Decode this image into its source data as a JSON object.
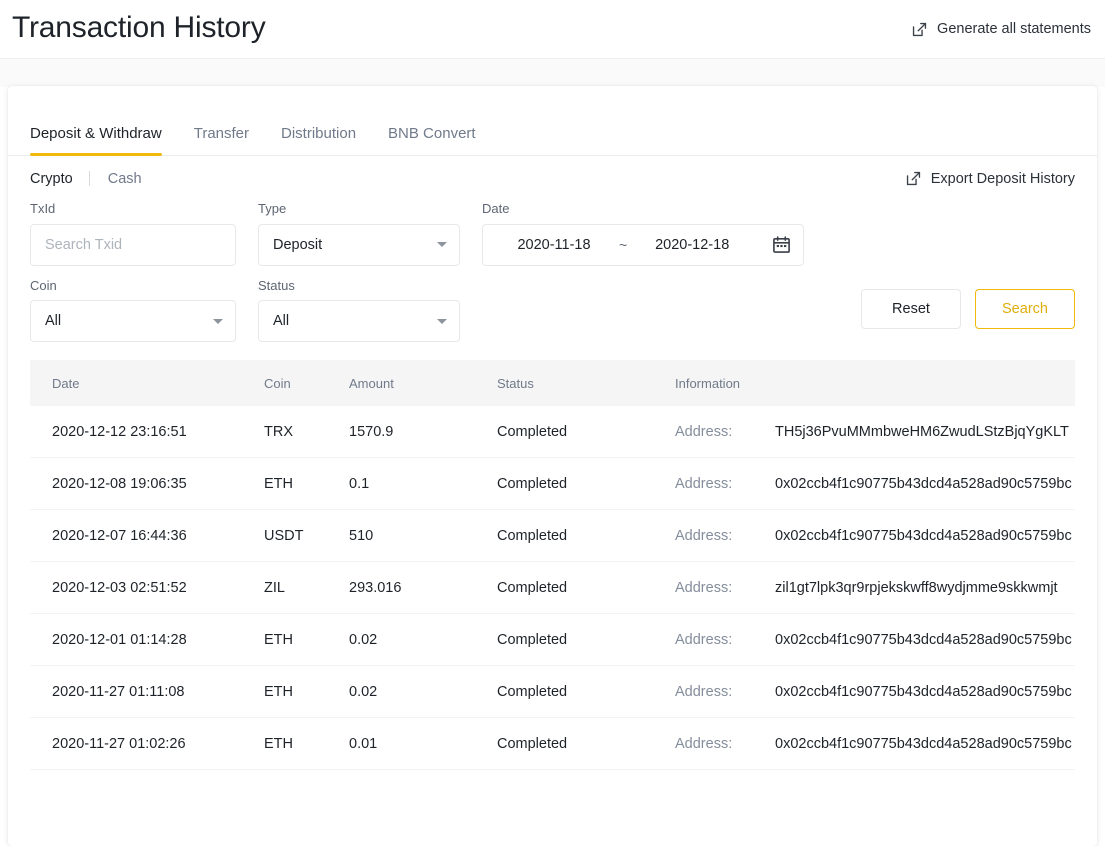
{
  "header": {
    "title": "Transaction History",
    "generate_label": "Generate all statements",
    "generate_icon": "external-link-icon"
  },
  "tabs": [
    {
      "label": "Deposit & Withdraw",
      "active": true
    },
    {
      "label": "Transfer",
      "active": false
    },
    {
      "label": "Distribution",
      "active": false
    },
    {
      "label": "BNB Convert",
      "active": false
    }
  ],
  "subtabs": [
    {
      "label": "Crypto",
      "active": true
    },
    {
      "label": "Cash",
      "active": false
    }
  ],
  "export": {
    "label": "Export Deposit History",
    "icon": "external-link-icon"
  },
  "filters": {
    "txid": {
      "label": "TxId",
      "placeholder": "Search Txid",
      "value": ""
    },
    "type": {
      "label": "Type",
      "value": "Deposit"
    },
    "date": {
      "label": "Date",
      "start": "2020-11-18",
      "separator": "~",
      "end": "2020-12-18",
      "icon": "calendar-icon"
    },
    "coin": {
      "label": "Coin",
      "value": "All"
    },
    "status": {
      "label": "Status",
      "value": "All"
    },
    "reset_label": "Reset",
    "search_label": "Search"
  },
  "table": {
    "columns": [
      "Date",
      "Coin",
      "Amount",
      "Status",
      "Information"
    ],
    "address_label": "Address:",
    "rows": [
      {
        "date": "2020-12-12 23:16:51",
        "coin": "TRX",
        "amount": "1570.9",
        "status": "Completed",
        "address": "TH5j36PvuMMmbweHM6ZwudLStzBjqYgKLT"
      },
      {
        "date": "2020-12-08 19:06:35",
        "coin": "ETH",
        "amount": "0.1",
        "status": "Completed",
        "address": "0x02ccb4f1c90775b43dcd4a528ad90c5759bc"
      },
      {
        "date": "2020-12-07 16:44:36",
        "coin": "USDT",
        "amount": "510",
        "status": "Completed",
        "address": "0x02ccb4f1c90775b43dcd4a528ad90c5759bc"
      },
      {
        "date": "2020-12-03 02:51:52",
        "coin": "ZIL",
        "amount": "293.016",
        "status": "Completed",
        "address": "zil1gt7lpk3qr9rpjekskwff8wydjmme9skkwmjt"
      },
      {
        "date": "2020-12-01 01:14:28",
        "coin": "ETH",
        "amount": "0.02",
        "status": "Completed",
        "address": "0x02ccb4f1c90775b43dcd4a528ad90c5759bc"
      },
      {
        "date": "2020-11-27 01:11:08",
        "coin": "ETH",
        "amount": "0.02",
        "status": "Completed",
        "address": "0x02ccb4f1c90775b43dcd4a528ad90c5759bc"
      },
      {
        "date": "2020-11-27 01:02:26",
        "coin": "ETH",
        "amount": "0.01",
        "status": "Completed",
        "address": "0x02ccb4f1c90775b43dcd4a528ad90c5759bc"
      }
    ]
  },
  "colors": {
    "accent": "#f0b90b",
    "text_primary": "#1e2329",
    "text_secondary": "#707a8a",
    "card_bg": "#ffffff",
    "page_bg": "#fafafa",
    "table_header_bg": "#f5f5f5"
  }
}
